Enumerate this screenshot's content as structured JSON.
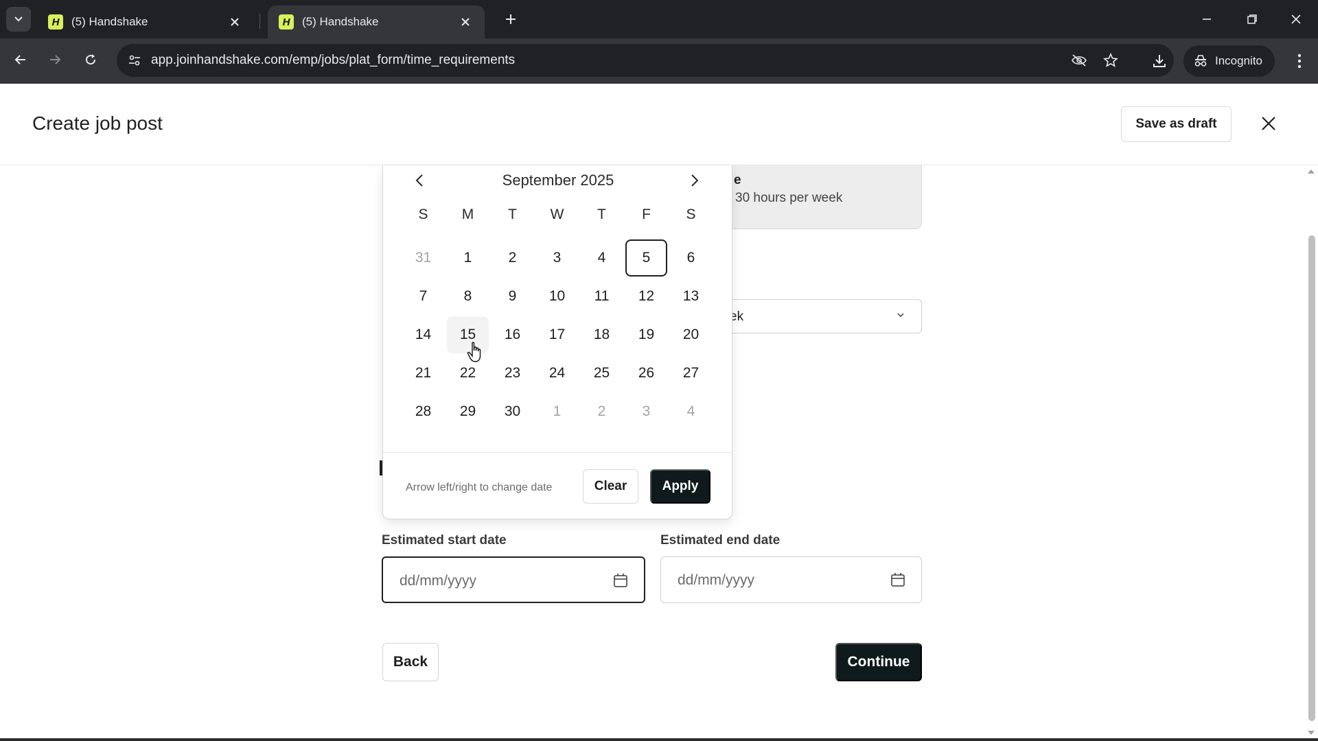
{
  "browser": {
    "tabs": [
      {
        "title": "(5) Handshake",
        "favicon": "H",
        "active": false
      },
      {
        "title": "(5) Handshake",
        "favicon": "H",
        "active": true
      }
    ],
    "url": "app.joinhandshake.com/emp/jobs/plat_form/time_requirements",
    "profile_label": "Incognito"
  },
  "header": {
    "title": "Create job post",
    "save_draft_label": "Save as draft"
  },
  "form": {
    "option_card": {
      "title": "e",
      "description": "30 hours per week"
    },
    "hours_select_value": "ek",
    "start_date": {
      "label": "Estimated start date",
      "placeholder": "dd/mm/yyyy"
    },
    "end_date": {
      "label": "Estimated end date",
      "placeholder": "dd/mm/yyyy"
    },
    "back_label": "Back",
    "continue_label": "Continue"
  },
  "date_picker": {
    "month_label": "September 2025",
    "weekdays": [
      "S",
      "M",
      "T",
      "W",
      "T",
      "F",
      "S"
    ],
    "days": [
      {
        "label": "31",
        "muted": true
      },
      {
        "label": "1"
      },
      {
        "label": "2"
      },
      {
        "label": "3"
      },
      {
        "label": "4"
      },
      {
        "label": "5",
        "today": true
      },
      {
        "label": "6"
      },
      {
        "label": "7"
      },
      {
        "label": "8"
      },
      {
        "label": "9"
      },
      {
        "label": "10"
      },
      {
        "label": "11"
      },
      {
        "label": "12"
      },
      {
        "label": "13"
      },
      {
        "label": "14"
      },
      {
        "label": "15",
        "hover": true
      },
      {
        "label": "16"
      },
      {
        "label": "17"
      },
      {
        "label": "18"
      },
      {
        "label": "19"
      },
      {
        "label": "20"
      },
      {
        "label": "21"
      },
      {
        "label": "22"
      },
      {
        "label": "23"
      },
      {
        "label": "24"
      },
      {
        "label": "25"
      },
      {
        "label": "26"
      },
      {
        "label": "27"
      },
      {
        "label": "28"
      },
      {
        "label": "29"
      },
      {
        "label": "30"
      },
      {
        "label": "1",
        "muted": true
      },
      {
        "label": "2",
        "muted": true
      },
      {
        "label": "3",
        "muted": true
      },
      {
        "label": "4",
        "muted": true
      }
    ],
    "hint": "Arrow left/right to change date",
    "clear_label": "Clear",
    "apply_label": "Apply"
  },
  "colors": {
    "brand_favicon": "#d8f05a",
    "primary_button": "#0e1a1c",
    "chrome_dark": "#202124",
    "chrome_toolbar": "#35363a"
  }
}
